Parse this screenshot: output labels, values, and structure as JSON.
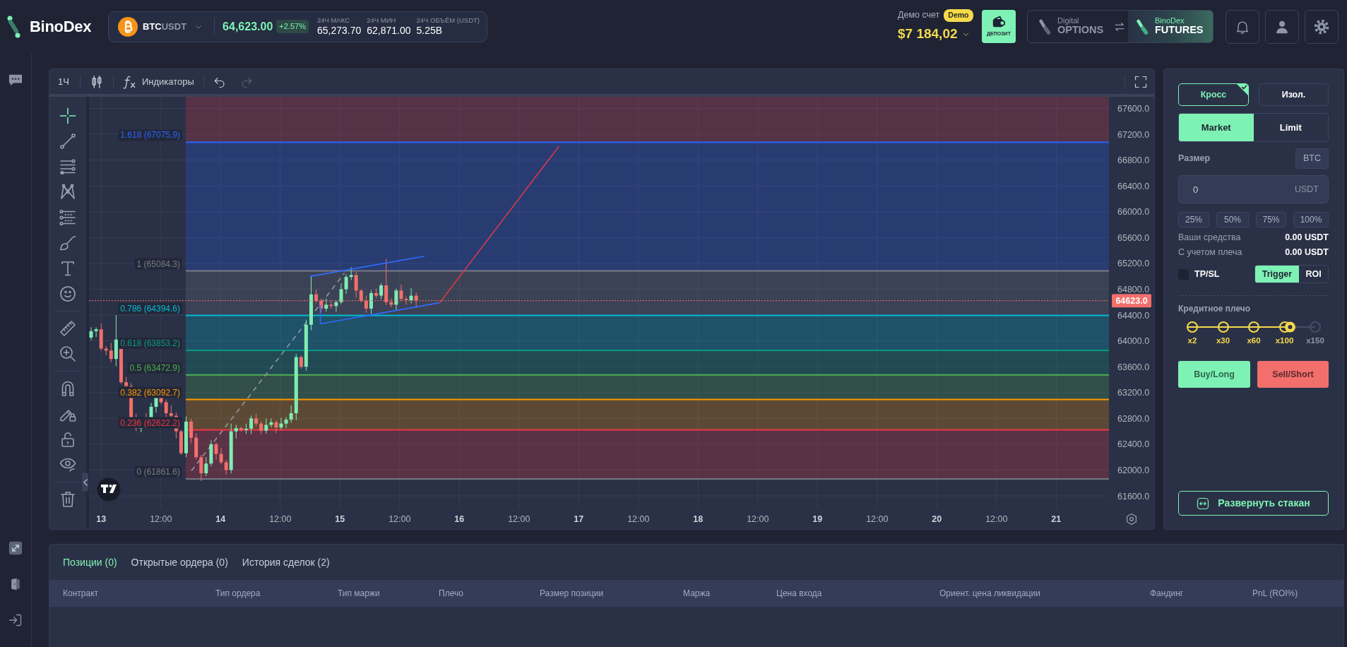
{
  "topbar": {
    "logo": "BinoDex",
    "pair": {
      "base": "BTC",
      "quote": "USDT"
    },
    "price": "64,623.00",
    "change": "+2.57%",
    "stats": [
      {
        "label": "24Ч МАКС",
        "value": "65,273.70"
      },
      {
        "label": "24Ч МИН",
        "value": "62,871.00"
      },
      {
        "label": "24Ч ОБЪЁМ (USDT)",
        "value": "5.25B"
      }
    ],
    "account": {
      "label": "Демо счет",
      "badge": "Demo",
      "balance": "$7 184,02"
    },
    "deposit": "ДЕПОЗИТ",
    "products": [
      {
        "caption": "Digital",
        "name": "OPTIONS",
        "selected": false
      },
      {
        "caption": "BinoDex",
        "name": "FUTURES",
        "selected": true
      }
    ]
  },
  "chart": {
    "interval": "1Ч",
    "indicators": "Индикаторы",
    "history": [
      {
        "kind": "undo",
        "disabled": false
      },
      {
        "kind": "redo",
        "disabled": true
      }
    ],
    "tool_groups": [
      [
        {
          "kind": "crosshair",
          "selected": true
        },
        {
          "kind": "line",
          "selected": false
        },
        {
          "kind": "hlines",
          "selected": false
        },
        {
          "kind": "pattern",
          "selected": false
        },
        {
          "kind": "channel",
          "selected": false
        },
        {
          "kind": "brush",
          "selected": false
        },
        {
          "kind": "text",
          "selected": false
        },
        {
          "kind": "emoji",
          "selected": false
        }
      ],
      [
        {
          "kind": "ruler",
          "selected": false
        },
        {
          "kind": "zoom",
          "selected": false
        }
      ],
      [
        {
          "kind": "magnet",
          "selected": false
        },
        {
          "kind": "drawlock",
          "selected": false
        },
        {
          "kind": "lock",
          "selected": false
        },
        {
          "kind": "eye",
          "selected": false
        }
      ],
      [
        {
          "kind": "trash",
          "selected": false
        }
      ]
    ],
    "fib_levels": [
      {
        "label": "1.618 (67075.9)",
        "color": "#2962ff"
      },
      {
        "label": "1 (65084.3)",
        "color": "#787b86"
      },
      {
        "label": "0.786 (64394.6)",
        "color": "#00bcd4"
      },
      {
        "label": "0.618 (63853.2)",
        "color": "#089981"
      },
      {
        "label": "0.5 (63472.9)",
        "color": "#4caf50"
      },
      {
        "label": "0.382 (63092.7)",
        "color": "#ff9800"
      },
      {
        "label": "0.236 (62622.2)",
        "color": "#f23645"
      },
      {
        "label": "0 (61861.6)",
        "color": "#787b86"
      }
    ],
    "price_axis": [
      "67600.0",
      "67200.0",
      "66800.0",
      "66400.0",
      "66000.0",
      "65600.0",
      "65200.0",
      "64800.0",
      "64400.0",
      "64000.0",
      "63600.0",
      "63200.0",
      "62800.0",
      "62400.0",
      "62000.0",
      "61600.0"
    ],
    "last_price": "64623.0",
    "time_axis": [
      {
        "text": "13",
        "kind": "day"
      },
      {
        "text": "12:00",
        "kind": "time"
      },
      {
        "text": "14",
        "kind": "day"
      },
      {
        "text": "12:00",
        "kind": "time"
      },
      {
        "text": "15",
        "kind": "day"
      },
      {
        "text": "12:00",
        "kind": "time"
      },
      {
        "text": "16",
        "kind": "day"
      },
      {
        "text": "12:00",
        "kind": "time"
      },
      {
        "text": "17",
        "kind": "day"
      },
      {
        "text": "12:00",
        "kind": "time"
      },
      {
        "text": "18",
        "kind": "day"
      },
      {
        "text": "12:00",
        "kind": "time"
      },
      {
        "text": "19",
        "kind": "day"
      },
      {
        "text": "12:00",
        "kind": "time"
      },
      {
        "text": "20",
        "kind": "day"
      },
      {
        "text": "12:00",
        "kind": "time"
      },
      {
        "text": "21",
        "kind": "day"
      }
    ]
  },
  "order_panel": {
    "margin_modes": [
      {
        "label": "Кросс",
        "selected": true
      },
      {
        "label": "Изол.",
        "selected": false
      }
    ],
    "order_types": [
      {
        "label": "Market",
        "selected": true
      },
      {
        "label": "Limit",
        "selected": false
      }
    ],
    "size": {
      "label": "Размер",
      "unit": "BTC",
      "value": "0",
      "suffix": "USDT"
    },
    "percents": [
      "25%",
      "50%",
      "75%",
      "100%"
    ],
    "balances": [
      {
        "label": "Ваши средства",
        "value": "0.00 USDT"
      },
      {
        "label": "С учетом плеча",
        "value": "0.00 USDT"
      }
    ],
    "tpsl": {
      "label": "TP/SL",
      "checked": false,
      "modes": [
        {
          "label": "Trigger",
          "selected": true
        },
        {
          "label": "ROI",
          "selected": false
        }
      ]
    },
    "leverage": {
      "label": "Кредитное плечо",
      "level": 0.75,
      "marks": [
        "x2",
        "x30",
        "x60",
        "x100",
        "x150"
      ]
    },
    "buy": "Buy/Long",
    "sell": "Sell/Short",
    "expand": "Развернуть стакан"
  },
  "positions": {
    "tabs": [
      {
        "label": "Позиции (0)",
        "selected": true
      },
      {
        "label": "Открытые ордера (0)",
        "selected": false
      },
      {
        "label": "История сделок (2)",
        "selected": false
      }
    ],
    "columns": [
      "Контракт",
      "Тип ордера",
      "Тип маржи",
      "Плечо",
      "Размер позиции",
      "Маржа",
      "Цена входа",
      "Ориент. цена ликвидации",
      "Фандинг",
      "PnL (ROI%)"
    ]
  }
}
